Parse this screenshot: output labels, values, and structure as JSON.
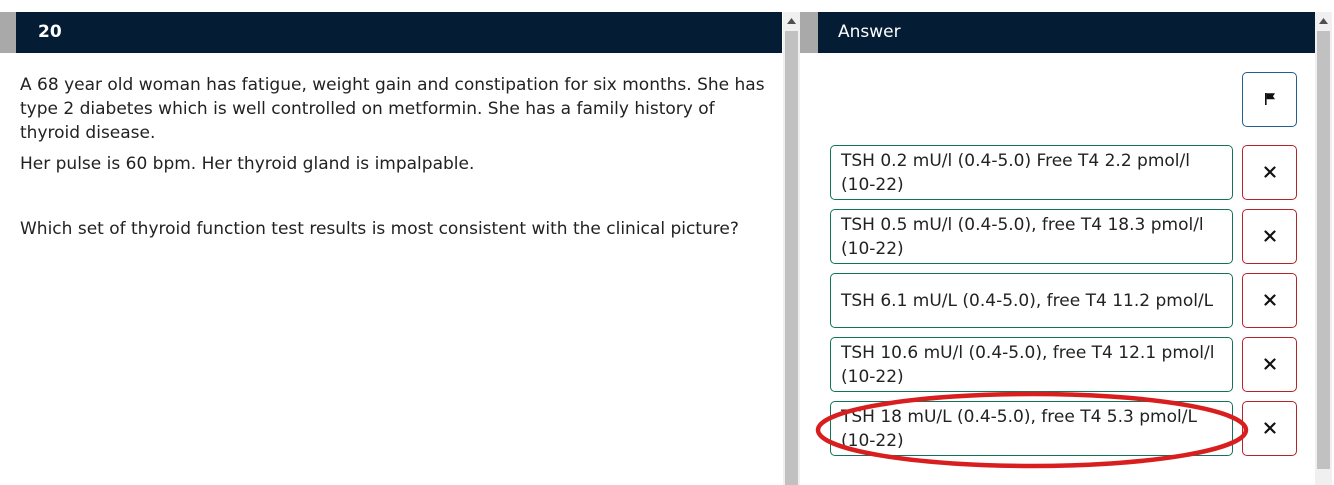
{
  "question": {
    "number": "20",
    "paragraphs": [
      "A 68 year old woman has fatigue, weight gain and constipation for six months.  She has type 2 diabetes which is well controlled on metformin.  She has a family history of thyroid disease.",
      "Her pulse is 60 bpm. Her thyroid gland is impalpable."
    ],
    "prompt": "Which set of thyroid function test results is most consistent with the clinical picture?"
  },
  "answer": {
    "title": "Answer",
    "flag_icon": "flag-icon",
    "options": [
      {
        "label": "TSH 0.2 mU/l (0.4-5.0) Free T4 2.2 pmol/l (10-22)"
      },
      {
        "label": "TSH 0.5 mU/l (0.4-5.0), free T4 18.3 pmol/l (10-22)"
      },
      {
        "label": "TSH 6.1 mU/L (0.4-5.0), free T4 11.2 pmol/L"
      },
      {
        "label": "TSH 10.6 mU/l (0.4-5.0), free T4 12.1 pmol/l (10-22)"
      },
      {
        "label": "TSH 18 mU/L (0.4-5.0), free T4 5.3 pmol/L (10-22)"
      }
    ],
    "eliminate_icon": "close-icon"
  },
  "colors": {
    "header_bg": "#041d35",
    "option_border": "#13735a",
    "eliminate_border": "#b5222a",
    "flag_border": "#1f5f92",
    "annotation": "#d81e1e"
  }
}
